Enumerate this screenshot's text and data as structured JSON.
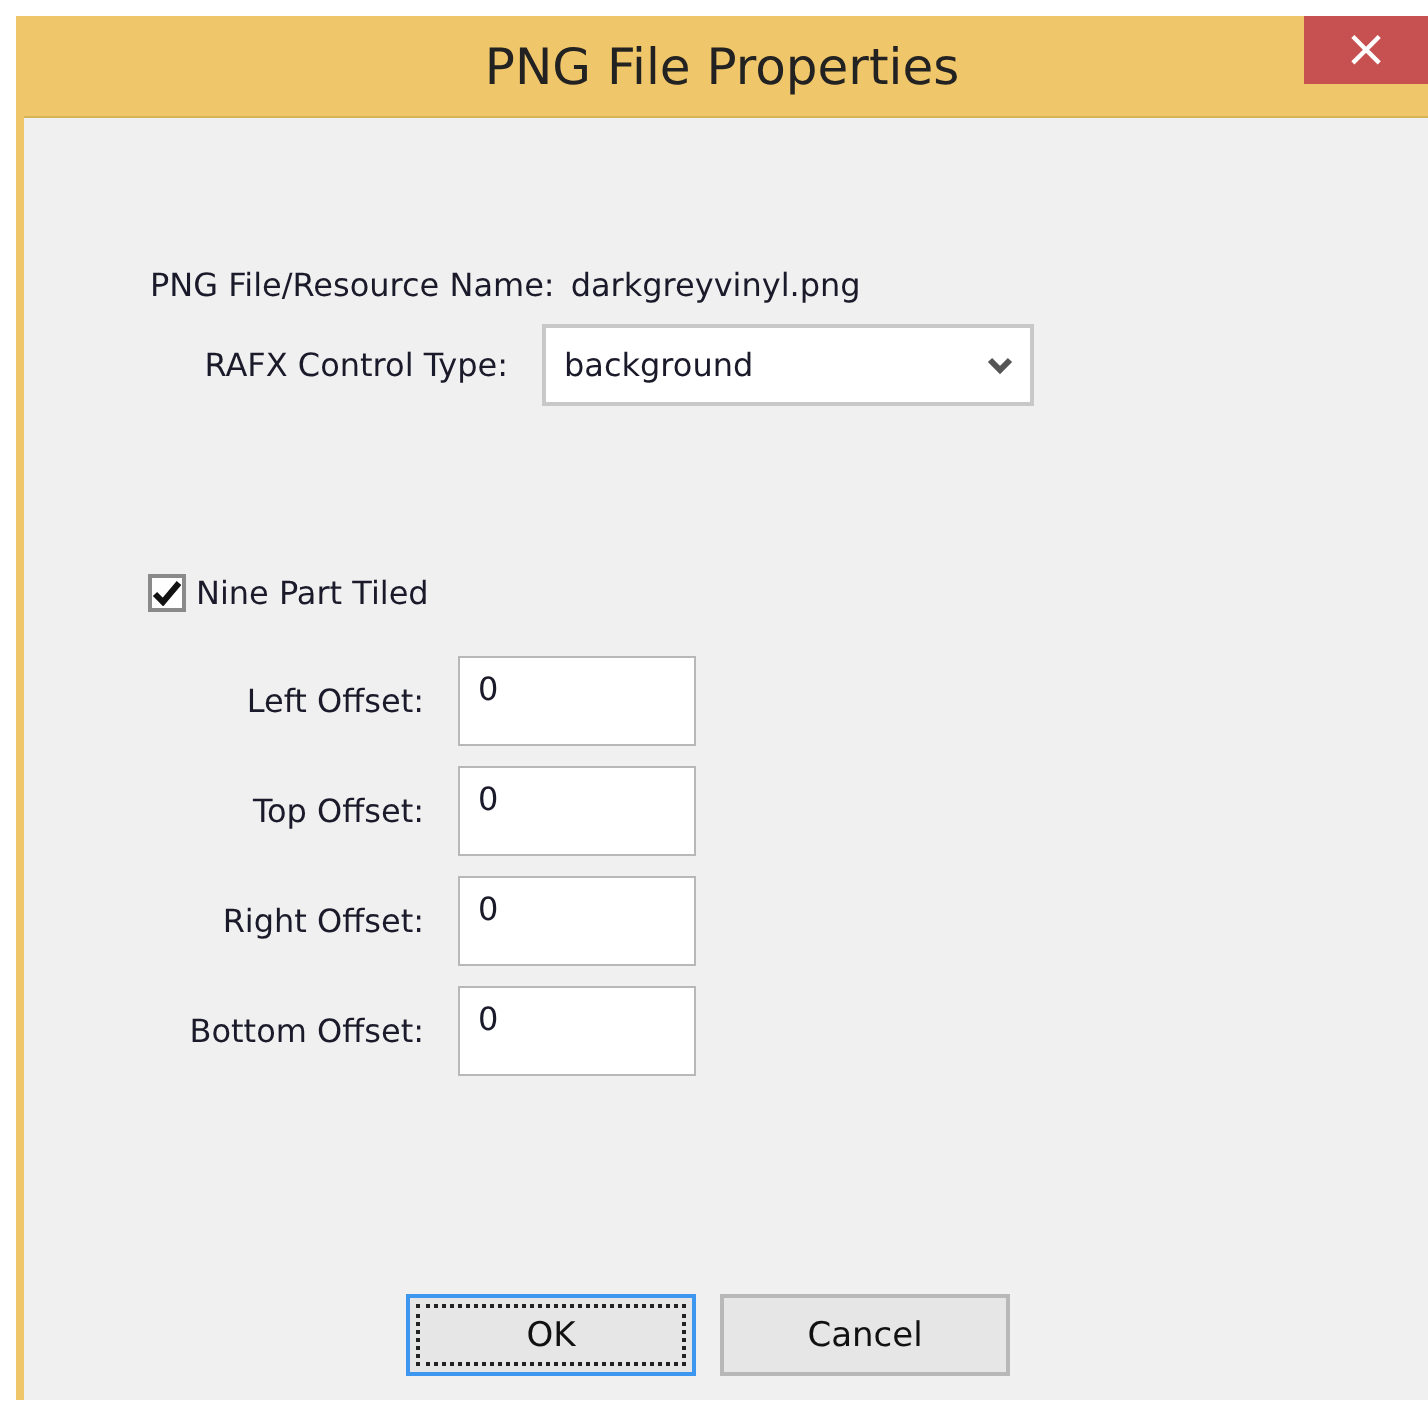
{
  "window": {
    "title": "PNG File Properties",
    "close": "×"
  },
  "resource_name": {
    "label": "PNG File/Resource Name:",
    "value": "darkgreyvinyl.png"
  },
  "control_type": {
    "label": "RAFX Control Type:",
    "value": "background"
  },
  "nine_part_tiled": {
    "label": "Nine Part Tiled",
    "checked": true
  },
  "offsets": [
    {
      "label": "Left Offset:",
      "value": "0"
    },
    {
      "label": "Top Offset:",
      "value": "0"
    },
    {
      "label": "Right Offset:",
      "value": "0"
    },
    {
      "label": "Bottom Offset:",
      "value": "0"
    }
  ],
  "buttons": [
    {
      "label": "OK",
      "focused": true
    },
    {
      "label": "Cancel",
      "focused": false
    }
  ]
}
